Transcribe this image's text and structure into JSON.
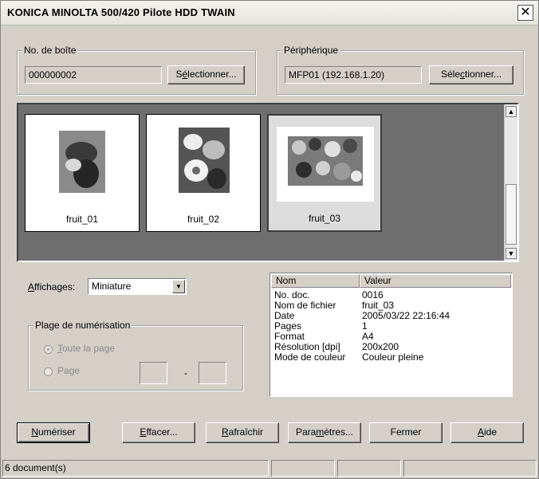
{
  "window": {
    "title": "KONICA MINOLTA 500/420 Pilote HDD TWAIN",
    "close_glyph": "✕"
  },
  "box": {
    "legend": "No. de boîte",
    "value": "000000002",
    "select_pre": "S",
    "select_key": "é",
    "select_post": "lectionner..."
  },
  "device": {
    "legend": "Périphérique",
    "value": "MFP01 (192.168.1.20)",
    "select_pre": "Séle",
    "select_key": "c",
    "select_post": "tionner..."
  },
  "thumbnails": [
    {
      "caption": "fruit_01",
      "selected": false
    },
    {
      "caption": "fruit_02",
      "selected": false
    },
    {
      "caption": "fruit_03",
      "selected": true
    }
  ],
  "view": {
    "label_key": "A",
    "label_rest": "ffichages:",
    "selected": "Miniature"
  },
  "range": {
    "legend": "Plage de numérisation",
    "whole_key": "T",
    "whole_rest": "oute la page",
    "page_pre": "Pa",
    "page_key": "g",
    "page_post": "e",
    "dash": "-"
  },
  "details": {
    "col_name": "Nom",
    "col_value": "Valeur",
    "rows": [
      {
        "name": "No. doc.",
        "value": "0016"
      },
      {
        "name": "Nom de fichier",
        "value": "fruit_03"
      },
      {
        "name": "Date",
        "value": "2005/03/22 22:16:44"
      },
      {
        "name": "Pages",
        "value": "1"
      },
      {
        "name": "Format",
        "value": "A4"
      },
      {
        "name": "Résolution [dpi]",
        "value": "200x200"
      },
      {
        "name": "Mode de couleur",
        "value": "Couleur pleine"
      }
    ]
  },
  "buttons": {
    "scan": {
      "key": "N",
      "rest": "umériser"
    },
    "erase": {
      "key": "E",
      "rest": "ffacer..."
    },
    "refresh": {
      "key": "R",
      "rest": "afraîchir"
    },
    "settings": {
      "pre": "Para",
      "key": "m",
      "rest": "ètres..."
    },
    "close": {
      "label": "Fermer"
    },
    "help": {
      "key": "A",
      "rest": "ide"
    }
  },
  "status": {
    "text": "6 document(s)"
  }
}
